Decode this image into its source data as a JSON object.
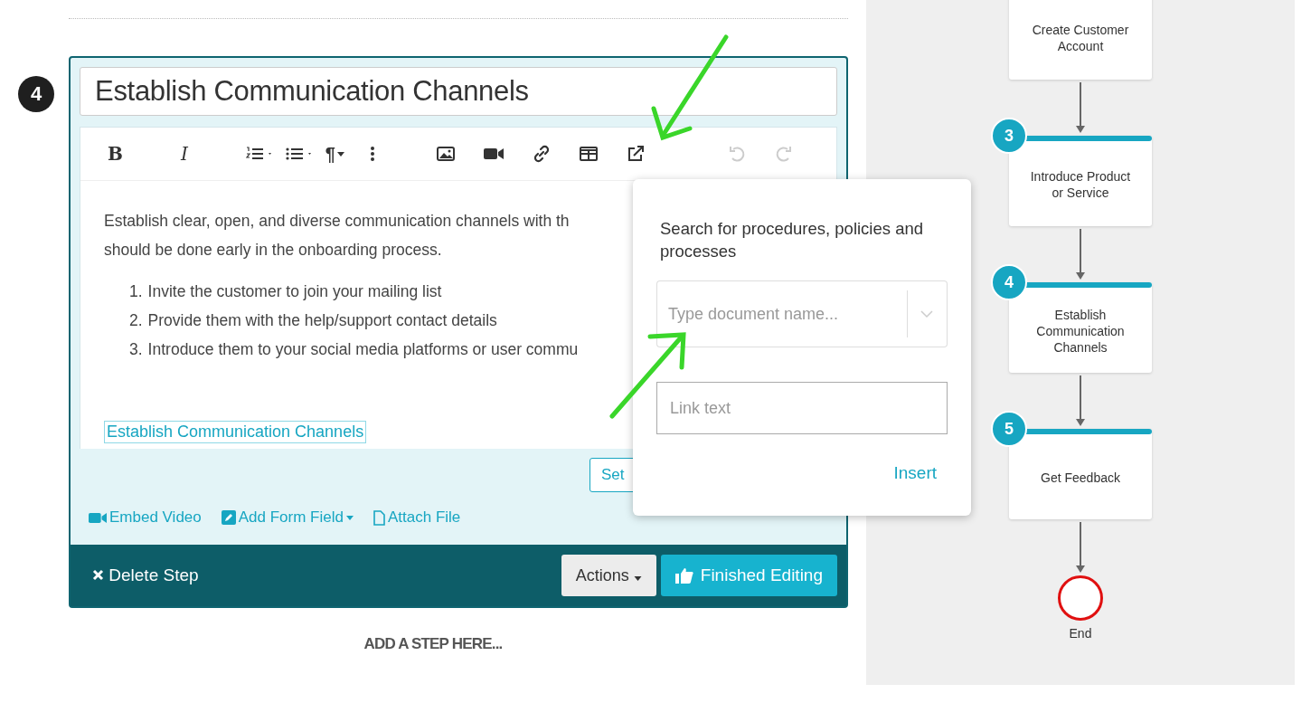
{
  "step": {
    "number": "4",
    "title": "Establish Communication Channels"
  },
  "toolbar": [
    {
      "kind": "bold",
      "label": "B",
      "disabled": false
    },
    {
      "kind": "italic",
      "label": "I",
      "disabled": false
    },
    {
      "kind": "ordered-list",
      "disabled": false
    },
    {
      "kind": "bullet-list",
      "disabled": false
    },
    {
      "kind": "paragraph",
      "label": "¶",
      "disabled": false
    },
    {
      "kind": "more",
      "disabled": false
    },
    {
      "kind": "image",
      "disabled": false
    },
    {
      "kind": "video",
      "disabled": false
    },
    {
      "kind": "link",
      "disabled": false
    },
    {
      "kind": "table",
      "disabled": false
    },
    {
      "kind": "external-link",
      "disabled": false
    },
    {
      "kind": "undo",
      "disabled": true
    },
    {
      "kind": "redo",
      "disabled": true
    }
  ],
  "content": {
    "lines": [
      "Establish clear, open, and diverse communication channels with th",
      "should be done early in the onboarding process."
    ],
    "list": [
      {
        "number": "1.",
        "text": "Invite the customer to join your mailing list"
      },
      {
        "number": "2.",
        "text": "Provide them with the help/support contact details"
      },
      {
        "number": "3.",
        "text": "Introduce them to your social media platforms or user commu"
      }
    ],
    "link": "Establish Communication Channels"
  },
  "hidden_button": "Set",
  "attachments": [
    {
      "kind": "video",
      "label": "Embed Video"
    },
    {
      "kind": "form",
      "label": "Add Form Field",
      "dropdown": true
    },
    {
      "kind": "file",
      "label": "Attach File"
    }
  ],
  "footer": {
    "delete": "Delete Step",
    "actions": "Actions",
    "finish": "Finished Editing"
  },
  "add_step": "ADD A STEP HERE...",
  "popup": {
    "title": "Search for procedures, policies and processes",
    "search_placeholder": "Type document name...",
    "link_placeholder": "Link text",
    "insert": "Insert"
  },
  "flow": [
    {
      "label": "Create Customer Account"
    },
    {
      "number": "3",
      "label": "Introduce Product or Service"
    },
    {
      "number": "4",
      "label": "Establish Communication Channels"
    },
    {
      "number": "5",
      "label": "Get Feedback"
    }
  ],
  "flow_end": "End"
}
